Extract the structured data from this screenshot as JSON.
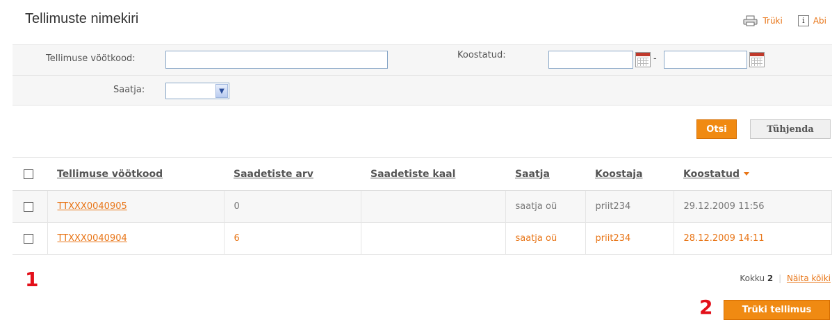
{
  "title": "Tellimuste nimekiri",
  "top_links": {
    "print": "Trüki",
    "help": "Abi"
  },
  "filters": {
    "barcode_label": "Tellimuse vöötkood:",
    "barcode_value": "",
    "created_label": "Koostatud:",
    "date_from": "",
    "date_separator": "-",
    "date_to": "",
    "sender_label": "Saatja:",
    "sender_value": ""
  },
  "buttons": {
    "search": "Otsi",
    "clear": "Tühjenda",
    "print_order": "Trüki tellimus"
  },
  "table": {
    "columns": [
      "Tellimuse vöötkood",
      "Saadetiste arv",
      "Saadetiste kaal",
      "Saatja",
      "Koostaja",
      "Koostatud"
    ],
    "rows": [
      {
        "barcode": "TTXXX0040905",
        "count": "0",
        "weight": "",
        "sender": "saatja oü",
        "creator": "priit234",
        "created": "29.12.2009 11:56"
      },
      {
        "barcode": "TTXXX0040904",
        "count": "6",
        "weight": "",
        "sender": "saatja oü",
        "creator": "priit234",
        "created": "28.12.2009 14:11"
      }
    ]
  },
  "footer": {
    "total_label": "Kokku",
    "total_value": "2",
    "show_all": "Näita kõiki"
  },
  "markers": {
    "one": "1",
    "two": "2"
  },
  "colors": {
    "accent": "#f08a12",
    "link": "#e87517",
    "marker": "#e3101a"
  }
}
